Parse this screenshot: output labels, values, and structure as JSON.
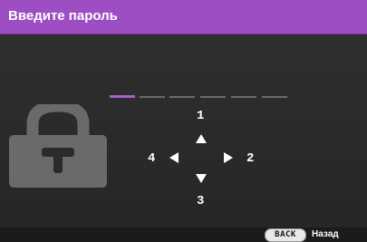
{
  "title": "Введите пароль",
  "keypad": {
    "up": "1",
    "right": "2",
    "down": "3",
    "left": "4"
  },
  "password_slots": 6,
  "entered_digits": 1,
  "footer": {
    "back_button": "BACK",
    "back_label": "Назад"
  },
  "colors": {
    "accent": "#9d4ec3",
    "active_slot": "#a05fd0"
  },
  "icons": [
    "lock-icon",
    "arrow-up-icon",
    "arrow-right-icon",
    "arrow-down-icon",
    "arrow-left-icon"
  ]
}
